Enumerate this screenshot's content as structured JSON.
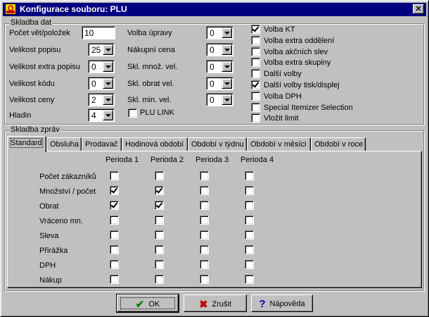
{
  "window": {
    "title": "Konfigurace souboru: PLU",
    "icon_letter": "Q"
  },
  "data_group": {
    "label": "Skladba dat",
    "fields_col1": [
      {
        "label": "Počet vět/položek",
        "type": "text",
        "value": "10"
      },
      {
        "label": "Velikost popisu",
        "type": "combo",
        "value": "25"
      },
      {
        "label": "Velikost extra popisu",
        "type": "combo",
        "value": "0"
      },
      {
        "label": "Velikost kódu",
        "type": "combo",
        "value": "0"
      },
      {
        "label": "Velikost ceny",
        "type": "combo",
        "value": "2"
      },
      {
        "label": "Hladin",
        "type": "combo",
        "value": "4"
      }
    ],
    "fields_col2": [
      {
        "label": "Volba úpravy",
        "value": "0"
      },
      {
        "label": "Nákupní cena",
        "value": "0"
      },
      {
        "label": "Skl. množ. vel.",
        "value": "0"
      },
      {
        "label": "Skl. obrat vel.",
        "value": "0"
      },
      {
        "label": "Skl. min. vel.",
        "value": "0"
      }
    ],
    "plu_link": {
      "label": "PLU LINK",
      "checked": false
    },
    "options": [
      {
        "label": "Volba KT",
        "checked": true
      },
      {
        "label": "Volba extra oddělení",
        "checked": false
      },
      {
        "label": "Volba akčních slev",
        "checked": false
      },
      {
        "label": "Volba extra skupiny",
        "checked": false
      },
      {
        "label": "Další volby",
        "checked": false
      },
      {
        "label": "Další volby tisk/displej",
        "checked": true
      },
      {
        "label": "Volba DPH",
        "checked": false
      },
      {
        "label": "Special Itemizer Selection",
        "checked": false
      },
      {
        "label": "Vložit limit",
        "checked": false
      }
    ]
  },
  "reports_group": {
    "label": "Skladba zpráv",
    "tabs": [
      "Standard",
      "Obsluha",
      "Prodavač",
      "Hodinová období",
      "Období v týdnu",
      "Období v měsíci",
      "Období v roce"
    ],
    "active_tab": 0,
    "periods": [
      "Perioda 1",
      "Perioda 2",
      "Perioda 3",
      "Perioda 4"
    ],
    "rows": [
      {
        "label": "Počet zákazníků",
        "checks": [
          false,
          false,
          false,
          false
        ]
      },
      {
        "label": "Množství / počet",
        "checks": [
          true,
          true,
          false,
          false
        ]
      },
      {
        "label": "Obrat",
        "checks": [
          true,
          true,
          false,
          false
        ]
      },
      {
        "label": "Vráceno mn.",
        "checks": [
          false,
          false,
          false,
          false
        ]
      },
      {
        "label": "Sleva",
        "checks": [
          false,
          false,
          false,
          false
        ]
      },
      {
        "label": "Přirážka",
        "checks": [
          false,
          false,
          false,
          false
        ]
      },
      {
        "label": "DPH",
        "checks": [
          false,
          false,
          false,
          false
        ]
      },
      {
        "label": "Nákup",
        "checks": [
          false,
          false,
          false,
          false
        ]
      }
    ]
  },
  "buttons": {
    "ok": {
      "label": "OK",
      "icon": "checkmark-icon",
      "color": "#008000"
    },
    "cancel": {
      "label": "Zrušit",
      "icon": "x-icon",
      "color": "#c00000"
    },
    "help": {
      "label": "Nápověda",
      "icon": "question-icon",
      "color": "#0000c0"
    }
  }
}
